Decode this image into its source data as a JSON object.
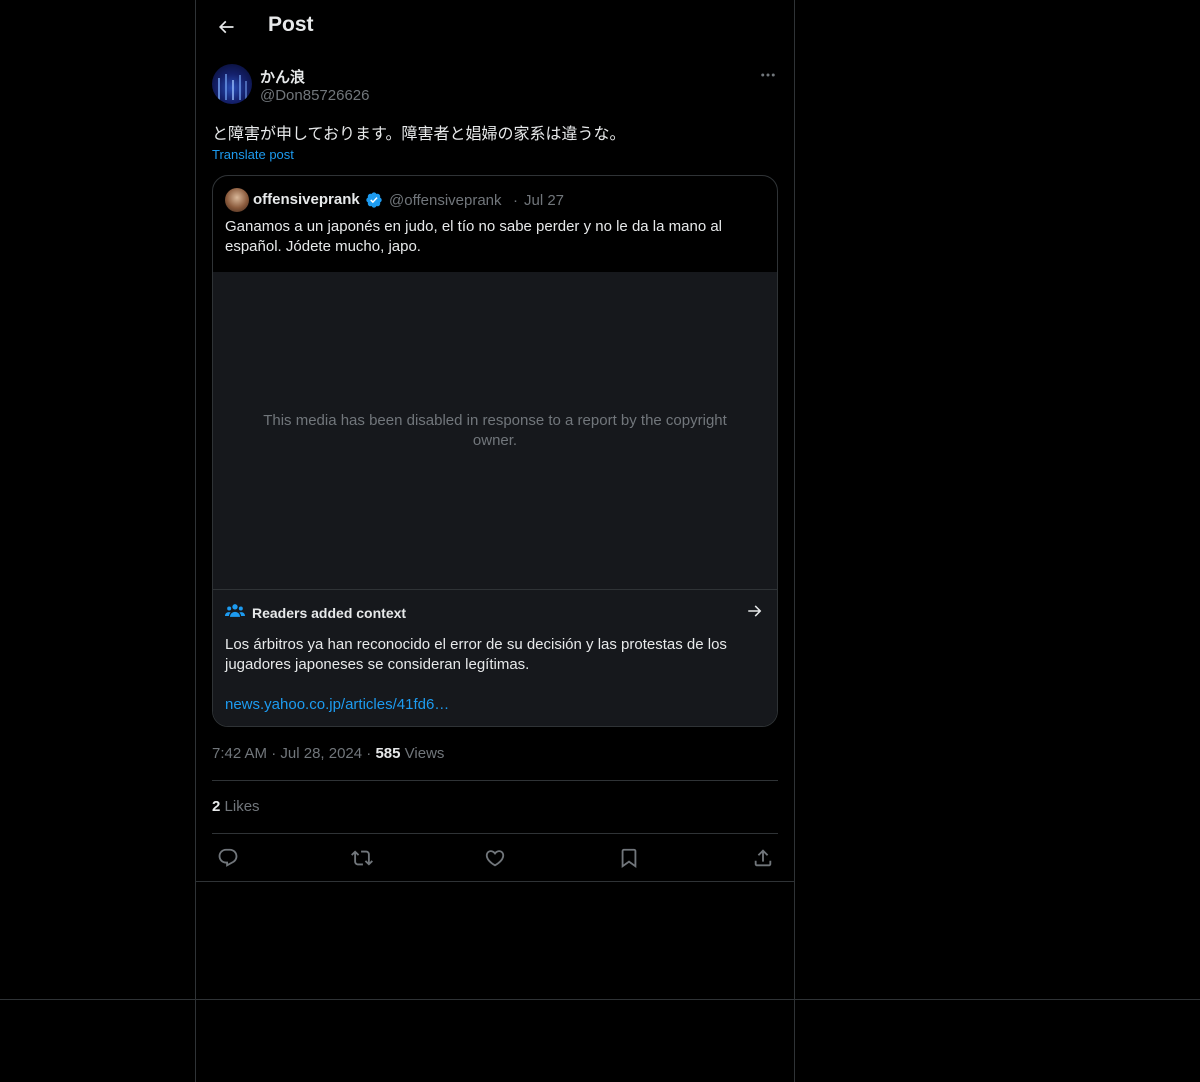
{
  "header": {
    "title": "Post",
    "back_icon": "arrow-left-icon"
  },
  "post": {
    "display_name": "かん浪",
    "handle": "@Don85726626",
    "text": "と障害が申しております。障害者と娼婦の家系は違うな。",
    "translate_label": "Translate post",
    "time": "7:42 AM",
    "date": "Jul 28, 2024",
    "views_count": "585",
    "views_label": "Views",
    "likes_count": "2",
    "likes_label": "Likes",
    "more_icon": "more-horizontal-icon"
  },
  "quote": {
    "display_name": "offensiveprank",
    "verified_icon": "verified-badge-icon",
    "handle": "@offensiveprank",
    "separator": "·",
    "date": "Jul 27",
    "text": "Ganamos a un japonés en judo, el tío no sabe perder y no le da la mano al español. Jódete mucho, japo.",
    "media_message": "This media has been disabled in response to a report by the copyright owner."
  },
  "context": {
    "title": "Readers added context",
    "text": "Los árbitros ya han reconocido el error de su decisión y las protestas de los jugadores japoneses se consideran legítimas.",
    "link": "news.yahoo.co.jp/articles/41fd6…"
  },
  "meta_separator": "·",
  "actions": [
    {
      "name": "reply-button",
      "icon": "reply-icon"
    },
    {
      "name": "repost-button",
      "icon": "repost-icon"
    },
    {
      "name": "like-button",
      "icon": "heart-icon"
    },
    {
      "name": "bookmark-button",
      "icon": "bookmark-icon"
    },
    {
      "name": "share-button",
      "icon": "share-icon"
    }
  ],
  "colors": {
    "background": "#000000",
    "text": "#e7e9ea",
    "muted": "#71767b",
    "accent": "#1d9bf0",
    "border": "#2f3336",
    "card": "#16181c"
  }
}
